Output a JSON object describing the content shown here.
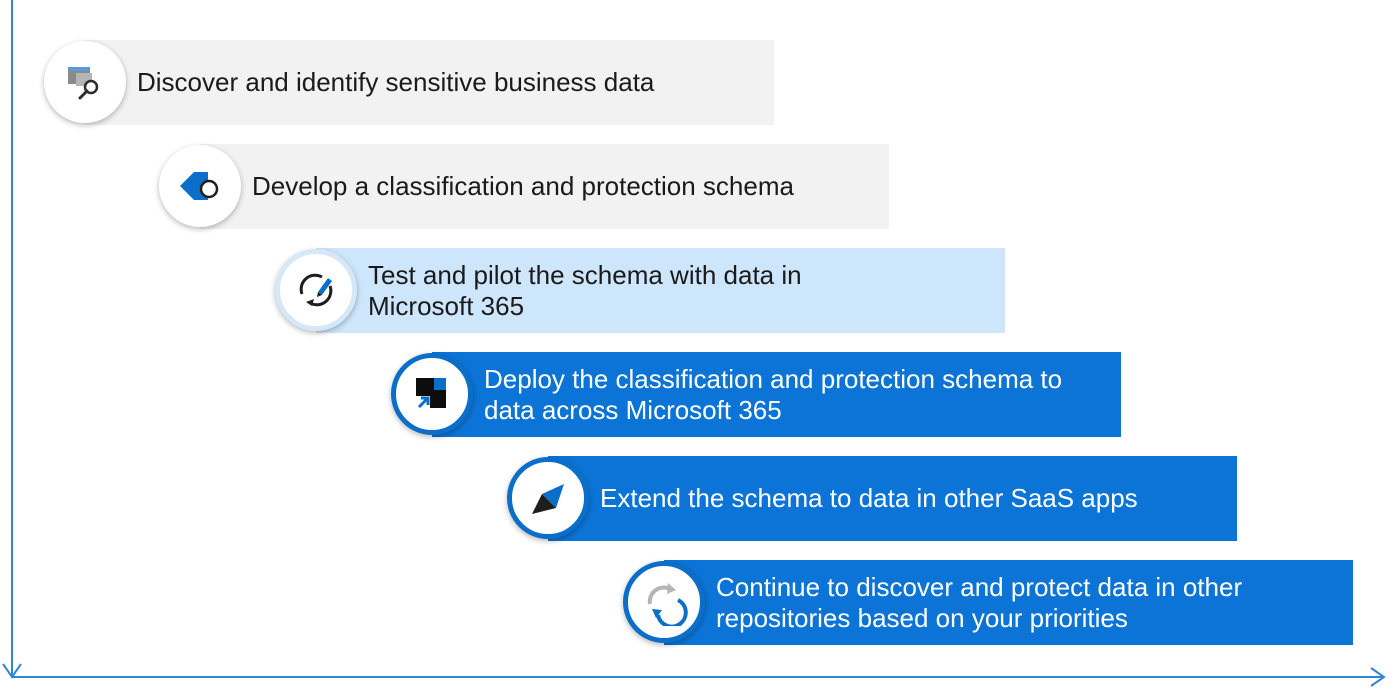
{
  "steps": [
    {
      "label": "Discover and identify sensitive business data",
      "icon": "discover-search-icon"
    },
    {
      "label": "Develop a classification and protection schema",
      "icon": "label-tag-icon"
    },
    {
      "label": "Test and pilot the schema with data in Microsoft 365",
      "icon": "test-pilot-icon"
    },
    {
      "label": "Deploy the classification and protection schema to data across Microsoft 365",
      "icon": "deploy-icon"
    },
    {
      "label": "Extend the schema to data in other SaaS apps",
      "icon": "extend-apps-icon"
    },
    {
      "label": "Continue to discover and protect data in other repositories based on your priorities",
      "icon": "refresh-cycle-icon"
    }
  ],
  "colors": {
    "axis": "#2f86d6",
    "light_gray": "#f2f2f2",
    "light_blue": "#cde6fb",
    "blue": "#0b74d6",
    "icon_blue": "#0b6fc9"
  }
}
